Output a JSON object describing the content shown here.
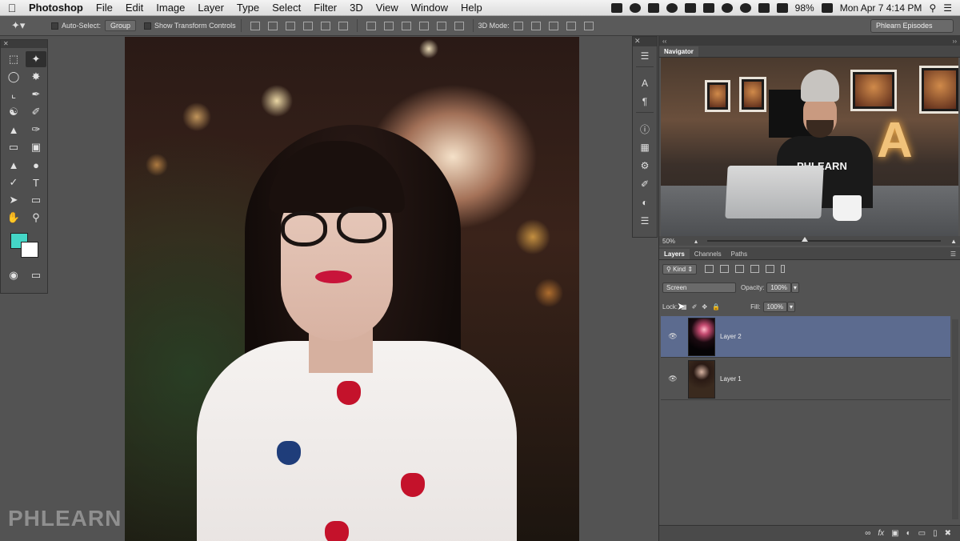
{
  "menubar": {
    "app_name": "Photoshop",
    "menus": [
      "File",
      "Edit",
      "Image",
      "Layer",
      "Type",
      "Select",
      "Filter",
      "3D",
      "View",
      "Window",
      "Help"
    ],
    "battery": "98%",
    "datetime": "Mon Apr 7  4:14 PM"
  },
  "options_bar": {
    "auto_select_label": "Auto-Select:",
    "auto_select_value": "Group",
    "transform_label": "Show Transform Controls",
    "mode_3d_label": "3D Mode:",
    "workspace": "Phlearn Episodes"
  },
  "canvas": {
    "watermark": "PHLEARN"
  },
  "navigator": {
    "title": "Navigator",
    "zoom": "50%",
    "preview_shirt_text": "PHLEARN",
    "preview_lamp_letter": "A"
  },
  "layers": {
    "tabs": [
      "Layers",
      "Channels",
      "Paths"
    ],
    "filter_kind": "Kind",
    "blend_mode": "Screen",
    "opacity_label": "Opacity:",
    "opacity_value": "100%",
    "lock_label": "Lock:",
    "fill_label": "Fill:",
    "fill_value": "100%",
    "items": [
      {
        "name": "Layer 2",
        "selected": true
      },
      {
        "name": "Layer 1",
        "selected": false
      }
    ],
    "footer_icons": [
      "link-icon",
      "fx-icon",
      "mask-icon",
      "adjustment-icon",
      "folder-icon",
      "new-layer-icon",
      "trash-icon"
    ]
  },
  "colors": {
    "foreground": "#44d6c6",
    "background": "#ffffff",
    "selected_layer": "#5c6b8f"
  }
}
